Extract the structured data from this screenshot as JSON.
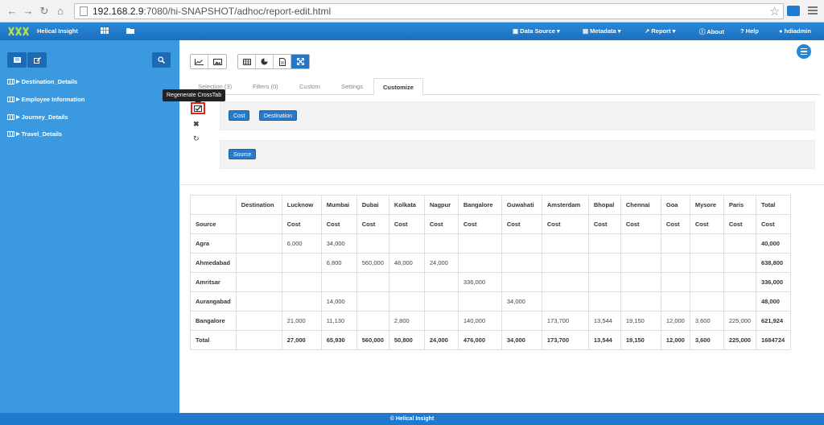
{
  "browser": {
    "url_host": "192.168.2.9",
    "url_rest": ":7080/hi-SNAPSHOT/adhoc/report-edit.html"
  },
  "header": {
    "brand": "Helical Insight",
    "menus": [
      "Data Source",
      "Metadata",
      "Report",
      "About",
      "Help",
      "hdiadmin"
    ]
  },
  "sidebar": {
    "items": [
      {
        "label": "Destination_Details"
      },
      {
        "label": "Employee Information"
      },
      {
        "label": "Journey_Details"
      },
      {
        "label": "Travel_Details"
      }
    ]
  },
  "tabs": [
    "Selection (3)",
    "Filters (0)",
    "Custom",
    "Settings",
    "Customize"
  ],
  "tooltip": "Regenerate CrossTab",
  "chips": {
    "columns": [
      "Cost",
      "Destination"
    ],
    "rows": [
      "Source"
    ]
  },
  "table": {
    "header": [
      "",
      "Destination",
      "Lucknow",
      "Mumbai",
      "Dubai",
      "Kolkata",
      "Nagpur",
      "Bangalore",
      "Guwahati",
      "Amsterdam",
      "Bhopal",
      "Chennai",
      "Goa",
      "Mysore",
      "Paris",
      "Total"
    ],
    "subheader": [
      "Source",
      "",
      "Cost",
      "Cost",
      "Cost",
      "Cost",
      "Cost",
      "Cost",
      "Cost",
      "Cost",
      "Cost",
      "Cost",
      "Cost",
      "Cost",
      "Cost",
      "Cost"
    ],
    "rows": [
      [
        "Agra",
        "",
        "6,000",
        "34,000",
        "",
        "",
        "",
        "",
        "",
        "",
        "",
        "",
        "",
        "",
        "",
        "40,000"
      ],
      [
        "Ahmedabad",
        "",
        "",
        "6,800",
        "560,000",
        "48,000",
        "24,000",
        "",
        "",
        "",
        "",
        "",
        "",
        "",
        "",
        "638,800"
      ],
      [
        "Amritsar",
        "",
        "",
        "",
        "",
        "",
        "",
        "336,000",
        "",
        "",
        "",
        "",
        "",
        "",
        "",
        "336,000"
      ],
      [
        "Aurangabad",
        "",
        "",
        "14,000",
        "",
        "",
        "",
        "",
        "34,000",
        "",
        "",
        "",
        "",
        "",
        "",
        "48,000"
      ],
      [
        "Bangalore",
        "",
        "21,000",
        "11,130",
        "",
        "2,800",
        "",
        "140,000",
        "",
        "173,700",
        "13,544",
        "19,150",
        "12,000",
        "3,600",
        "225,000",
        "621,924"
      ],
      [
        "Total",
        "",
        "27,000",
        "65,930",
        "560,000",
        "50,800",
        "24,000",
        "476,000",
        "34,000",
        "173,700",
        "13,544",
        "19,150",
        "12,000",
        "3,600",
        "225,000",
        "1684724"
      ]
    ]
  },
  "footer": "© Helical Insight"
}
